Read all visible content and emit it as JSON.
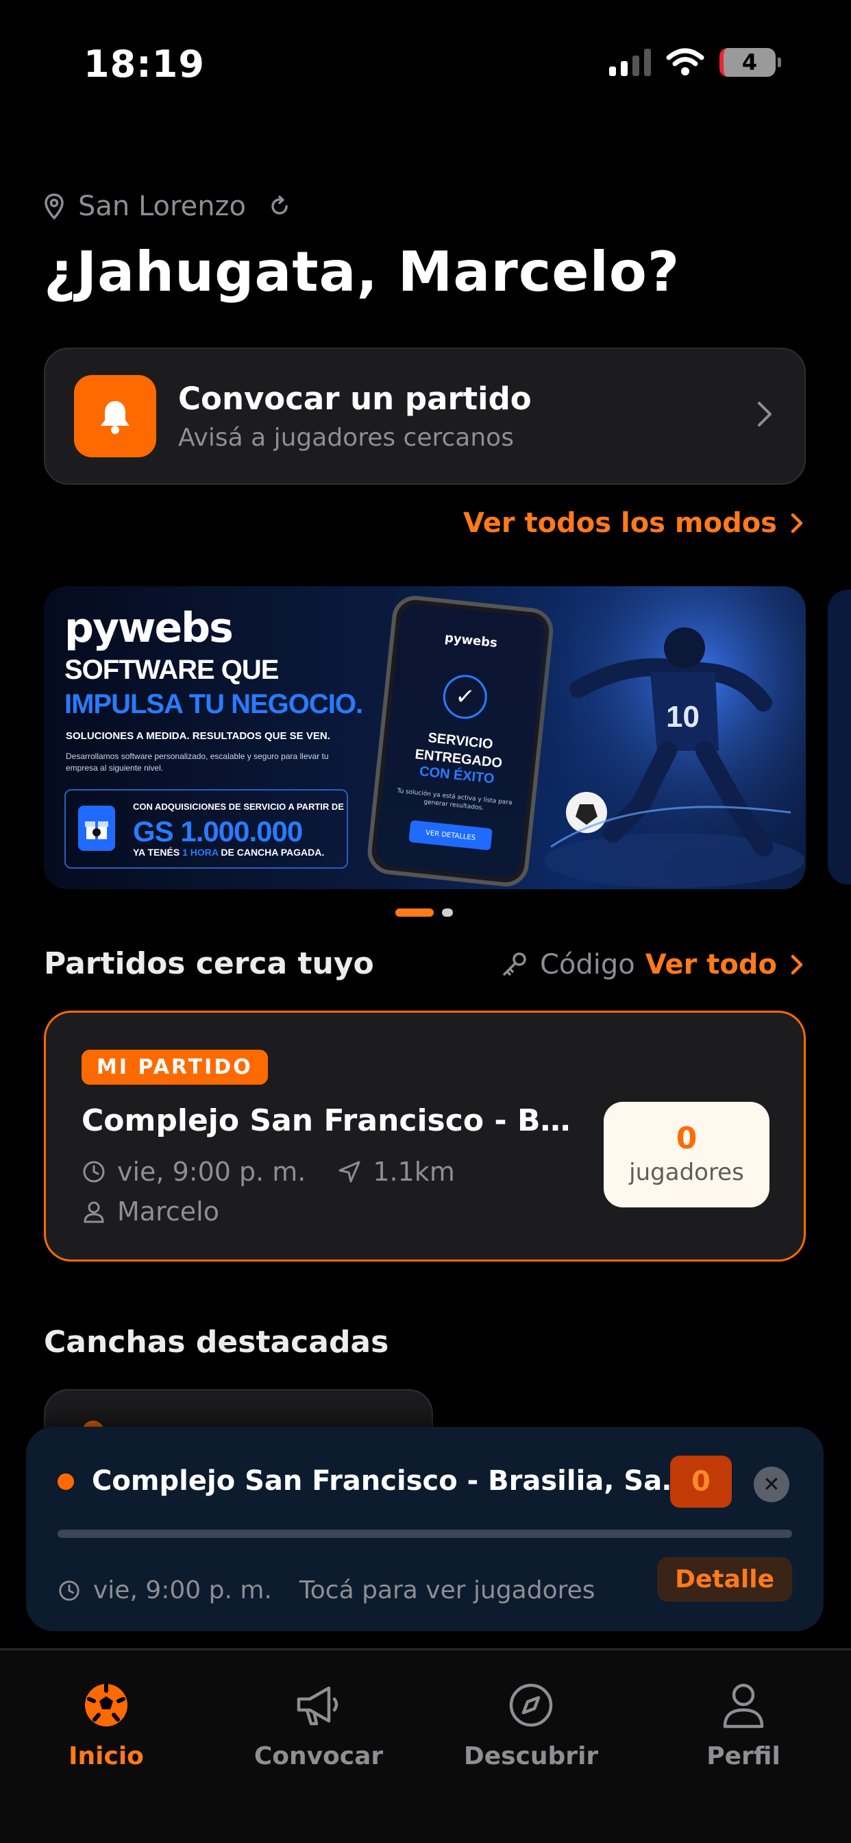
{
  "status_bar": {
    "time": "18:19",
    "battery": "4"
  },
  "location": {
    "city": "San Lorenzo"
  },
  "greeting": "¿Jahugata, Marcelo?",
  "convocar_card": {
    "title": "Convocar un partido",
    "subtitle": "Avisá a jugadores cercanos"
  },
  "ver_modos": "Ver todos los modos",
  "banner": {
    "logo": "pywebs",
    "headline_1": "SOFTWARE QUE",
    "headline_2": "IMPULSA TU NEGOCIO.",
    "tagline": "SOLUCIONES A MEDIDA. RESULTADOS QUE SE VEN.",
    "description": "Desarrollamos software personalizado, escalable y seguro para llevar tu empresa al siguiente nivel.",
    "offer_line_1": "CON ADQUISICIONES DE SERVICIO A PARTIR DE",
    "offer_amount": "GS 1.000.000",
    "offer_line_3a": "YA TENÉS ",
    "offer_line_3b": "1 HORA",
    "offer_line_3c": " DE CANCHA PAGADA.",
    "phone_logo": "pywebs",
    "phone_title_1": "SERVICIO",
    "phone_title_2": "ENTREGADO",
    "phone_title_3": "CON ÉXITO",
    "phone_text": "Tu solución ya está activa y lista para generar resultados.",
    "phone_button": "VER DETALLES",
    "jersey_number": "10"
  },
  "carousel": {
    "pages": 2,
    "active": 1
  },
  "partidos": {
    "title": "Partidos cerca tuyo",
    "codigo": "Código",
    "ver_todo": "Ver todo",
    "card": {
      "badge": "MI PARTIDO",
      "name": "Complejo San Francisco - Brasi...",
      "time": "vie, 9:00 p. m.",
      "distance": "1.1km",
      "organizer": "Marcelo",
      "players_count": "0",
      "players_label": "jugadores"
    }
  },
  "canchas": {
    "title": "Canchas destacadas"
  },
  "live_bar": {
    "title": "Complejo San Francisco - Brasilia, San L...",
    "count": "0",
    "progress": 0,
    "time": "vie, 9:00 p. m.",
    "hint": "Tocá para ver jugadores",
    "detail_label": "Detalle"
  },
  "tabbar": {
    "tabs": [
      {
        "label": "Inicio",
        "icon": "soccer-ball-icon",
        "active": true
      },
      {
        "label": "Convocar",
        "icon": "megaphone-icon",
        "active": false
      },
      {
        "label": "Descubrir",
        "icon": "compass-icon",
        "active": false
      },
      {
        "label": "Perfil",
        "icon": "user-icon",
        "active": false
      }
    ]
  },
  "colors": {
    "accent": "#ff6a00",
    "background": "#000000",
    "card": "#1c1c1e",
    "live_bar": "#0d1b2e"
  }
}
